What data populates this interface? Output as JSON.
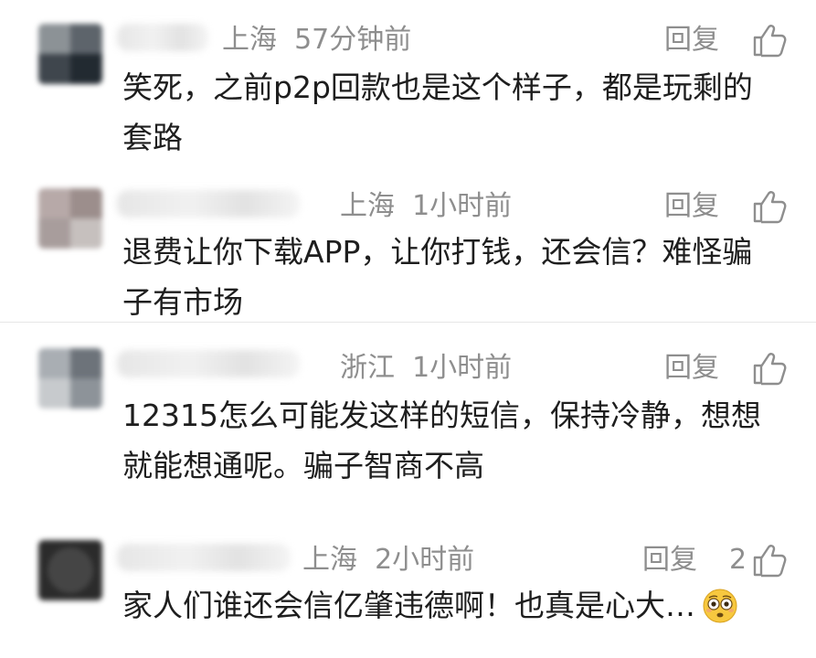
{
  "comments": [
    {
      "location": "上海",
      "time": "57分钟前",
      "reply_label": "回复",
      "like_count": "",
      "text": "笑死，之前p2p回款也是这个样子，都是玩剩的套路"
    },
    {
      "location": "上海",
      "time": "1小时前",
      "reply_label": "回复",
      "like_count": "",
      "text": "退费让你下载APP，让你打钱，还会信？难怪骗子有市场"
    },
    {
      "location": "浙江",
      "time": "1小时前",
      "reply_label": "回复",
      "like_count": "",
      "text": "12315怎么可能发这样的短信，保持冷静，想想就能想通呢。骗子智商不高"
    },
    {
      "location": "上海",
      "time": "2小时前",
      "reply_label": "回复",
      "like_count": "2",
      "text": "家人们谁还会信亿肇违德啊！也真是心大…",
      "emoji": "flushed-face-emoji"
    }
  ],
  "icons": {
    "like": "thumbs-up-icon"
  },
  "colors": {
    "meta": "#8e8e8e",
    "text": "#1e1e1e",
    "emoji": "#f7c83f"
  }
}
